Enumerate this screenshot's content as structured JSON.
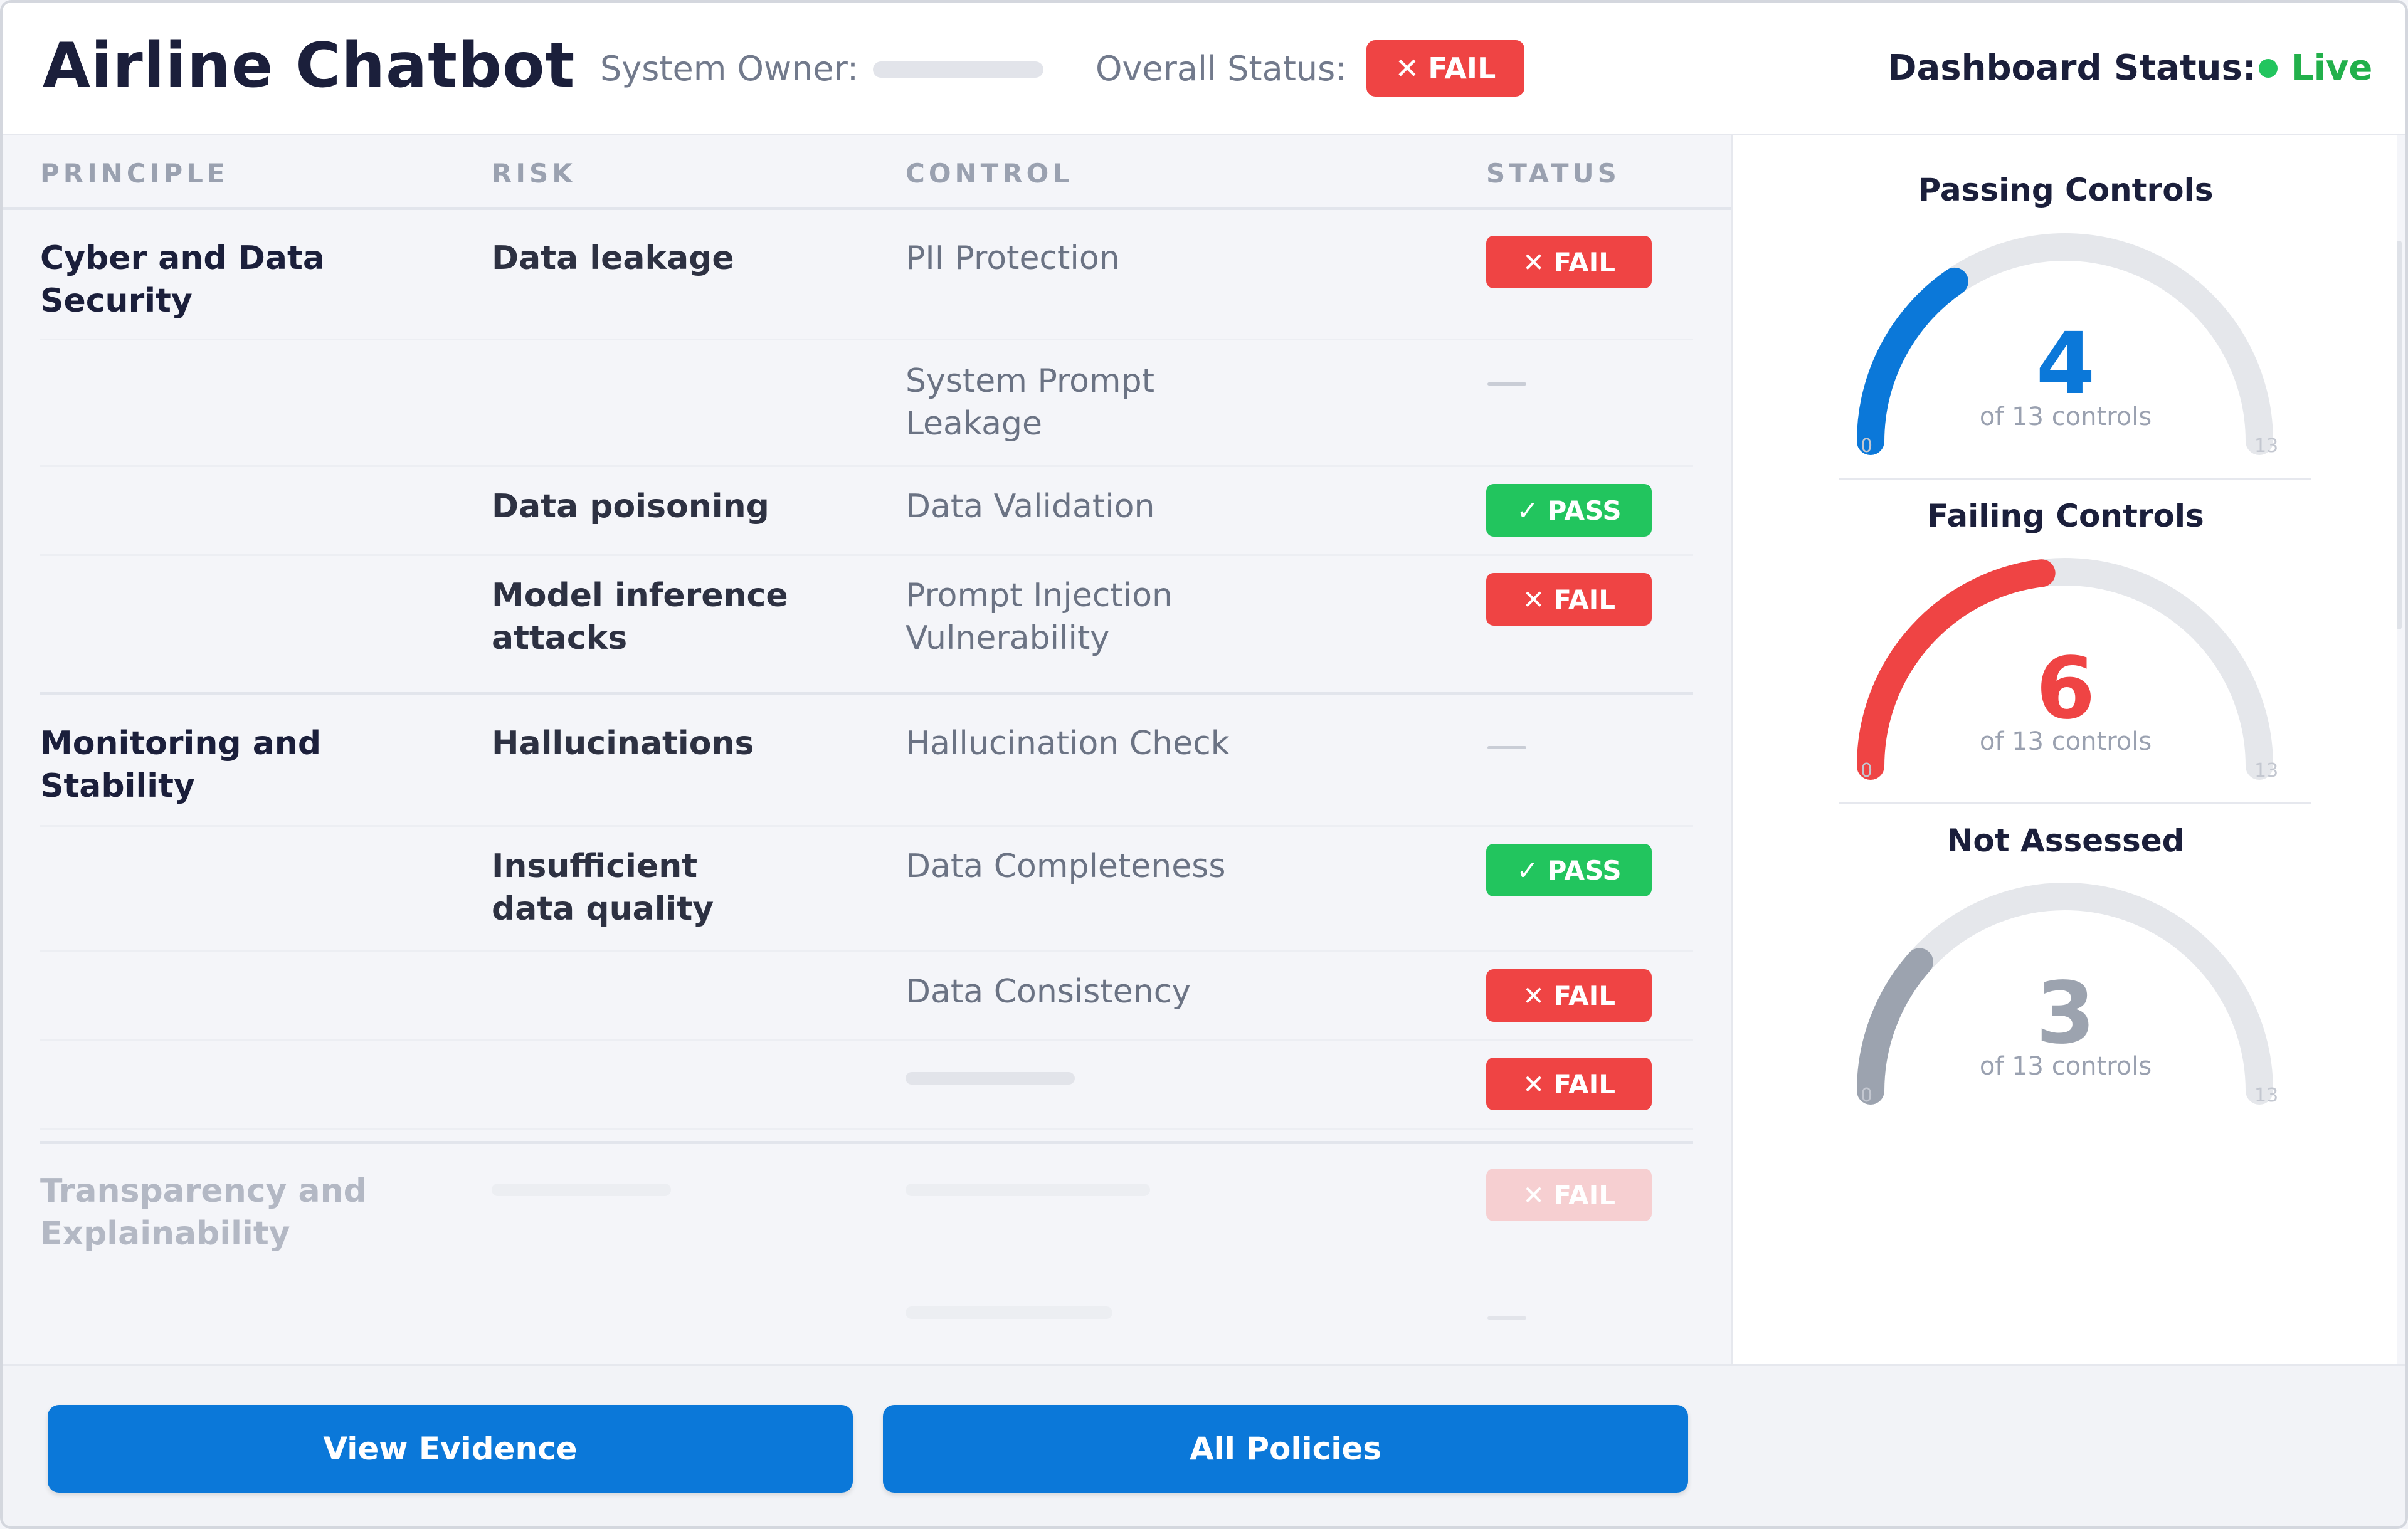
{
  "header": {
    "title": "Airline Chatbot",
    "owner_label": "System Owner:",
    "overall_label": "Overall Status:",
    "overall_status": "FAIL",
    "dashboard_label": "Dashboard Status:",
    "dashboard_status": "Live"
  },
  "table": {
    "columns": [
      "PRINCIPLE",
      "RISK",
      "CONTROL",
      "STATUS"
    ],
    "rows": [
      {
        "principle": "Cyber and Data Security",
        "risk": "Data leakage",
        "control": "PII Protection",
        "status": "FAIL"
      },
      {
        "principle": "",
        "risk": "",
        "control": "System Prompt Leakage",
        "status": "—"
      },
      {
        "principle": "",
        "risk": "Data poisoning",
        "control": "Data Validation",
        "status": "PASS"
      },
      {
        "principle": "",
        "risk": "Model inference attacks",
        "control": "Prompt Injection Vulnerability",
        "status": "FAIL"
      },
      {
        "principle": "Monitoring and Stability",
        "risk": "Hallucinations",
        "control": "Hallucination Check",
        "status": "—"
      },
      {
        "principle": "",
        "risk": "Insufficient data quality",
        "control": "Data Completeness",
        "status": "PASS"
      },
      {
        "principle": "",
        "risk": "",
        "control": "Data Consistency",
        "status": "FAIL"
      },
      {
        "principle": "",
        "risk": "",
        "control": "",
        "status": "FAIL"
      },
      {
        "principle": "Transparency and Explainability",
        "risk": "",
        "control": "",
        "status": "FAIL"
      },
      {
        "principle": "",
        "risk": "",
        "control": "",
        "status": "—"
      }
    ]
  },
  "gauges": [
    {
      "title": "Passing Controls",
      "value": 4,
      "max": 13,
      "subtitle": "of 13 controls",
      "min_label": "0",
      "max_label": "13",
      "color": "#0b78d9"
    },
    {
      "title": "Failing Controls",
      "value": 6,
      "max": 13,
      "subtitle": "of 13 controls",
      "min_label": "0",
      "max_label": "13",
      "color": "#ef4444"
    },
    {
      "title": "Not Assessed",
      "value": 3,
      "max": 13,
      "subtitle": "of 13 controls",
      "min_label": "0",
      "max_label": "13",
      "color": "#9ca3af"
    }
  ],
  "footer": {
    "view_evidence": "View Evidence",
    "all_policies": "All Policies"
  },
  "icons": {
    "fail": "x-icon",
    "pass": "check-icon",
    "live": "status-dot-icon"
  }
}
